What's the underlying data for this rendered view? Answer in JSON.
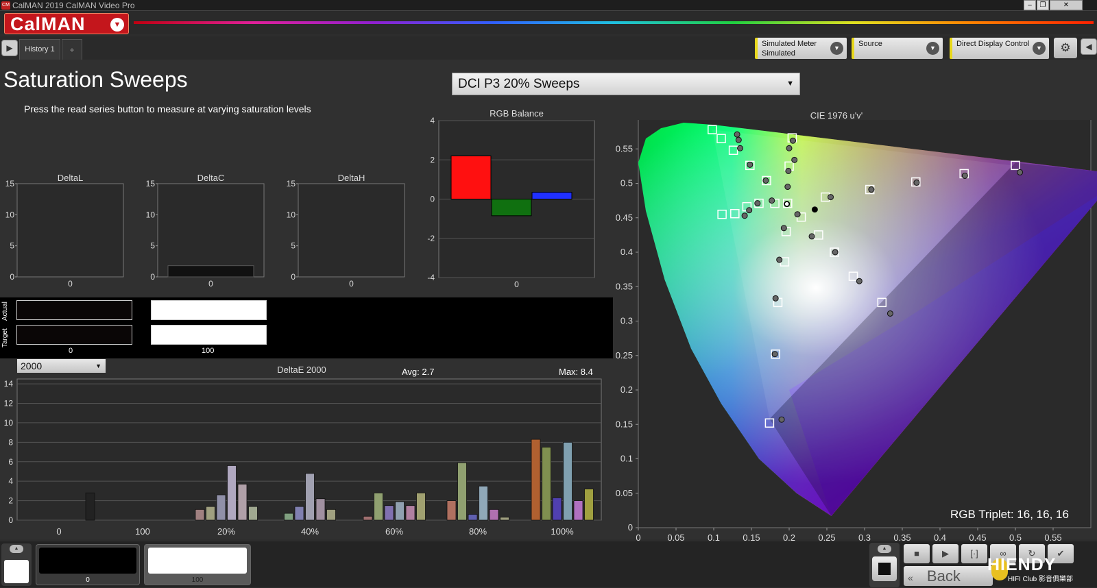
{
  "window": {
    "title": "CalMAN 2019 CalMAN Video Pro",
    "app_icon": "CM"
  },
  "brand": {
    "logo": "CalMAN"
  },
  "tabs": {
    "history": "History 1",
    "add": "+"
  },
  "devices": {
    "meter_label": "Simulated Meter",
    "meter_sub": "Simulated",
    "source_label": "Source",
    "display_label": "Direct Display Control"
  },
  "page": {
    "title": "Saturation Sweeps",
    "subtitle": "Press the read series button to measure at varying saturation levels",
    "series_select": "DCI P3 20% Sweeps"
  },
  "delta_charts": [
    {
      "title": "DeltaL",
      "yticks": [
        "15",
        "10",
        "5",
        "0"
      ],
      "xlabel": "0",
      "value": 0
    },
    {
      "title": "DeltaC",
      "yticks": [
        "15",
        "10",
        "5",
        "0"
      ],
      "xlabel": "0",
      "value": 1.8
    },
    {
      "title": "DeltaH",
      "yticks": [
        "15",
        "10",
        "5",
        "0"
      ],
      "xlabel": "0",
      "value": 0
    }
  ],
  "rgb_balance": {
    "title": "RGB Balance",
    "yticks": [
      "4",
      "2",
      "0",
      "-2",
      "-4"
    ],
    "xlabel": "0",
    "values": {
      "red": 2.2,
      "green": -0.85,
      "blue": 0.35
    }
  },
  "swatches": {
    "actual_label": "Actual",
    "target_label": "Target",
    "items": [
      {
        "label": "0",
        "color": "#0a0606"
      },
      {
        "label": "100",
        "color": "#ffffff"
      }
    ]
  },
  "deltae": {
    "title": "DeltaE 2000",
    "mode": "2000",
    "avg": "Avg: 2.7",
    "max": "Max: 8.4",
    "yticks": [
      "14",
      "12",
      "10",
      "8",
      "6",
      "4",
      "2",
      "0"
    ],
    "xticks": [
      "0",
      "100",
      "20%",
      "40%",
      "60%",
      "80%",
      "100%"
    ]
  },
  "chart_data": [
    {
      "type": "bar",
      "title": "DeltaE 2000",
      "ylim": [
        0,
        15
      ],
      "groups": [
        {
          "category": "0",
          "bars": [
            {
              "value": 2.8,
              "color": "#222222"
            }
          ]
        },
        {
          "category": "100",
          "bars": []
        },
        {
          "category": "20%",
          "bars": [
            {
              "value": 1.1,
              "color": "#a08080"
            },
            {
              "value": 1.4,
              "color": "#a0a080"
            },
            {
              "value": 2.6,
              "color": "#9090a8"
            },
            {
              "value": 5.6,
              "color": "#b0a8c0"
            },
            {
              "value": 3.7,
              "color": "#b0a0a8"
            },
            {
              "value": 1.4,
              "color": "#a0a890"
            }
          ]
        },
        {
          "category": "40%",
          "bars": [
            {
              "value": 0.7,
              "color": "#80a080"
            },
            {
              "value": 1.4,
              "color": "#8080b0"
            },
            {
              "value": 4.8,
              "color": "#a0a0b0"
            },
            {
              "value": 2.2,
              "color": "#a090a0"
            },
            {
              "value": 1.1,
              "color": "#a0a080"
            }
          ]
        },
        {
          "category": "60%",
          "bars": [
            {
              "value": 0.4,
              "color": "#a07070"
            },
            {
              "value": 2.8,
              "color": "#90a070"
            },
            {
              "value": 1.5,
              "color": "#8070b0"
            },
            {
              "value": 1.9,
              "color": "#90a0b0"
            },
            {
              "value": 1.5,
              "color": "#b080a0"
            },
            {
              "value": 2.8,
              "color": "#a0a070"
            }
          ]
        },
        {
          "category": "80%",
          "bars": [
            {
              "value": 2.0,
              "color": "#b07060"
            },
            {
              "value": 5.9,
              "color": "#90a070"
            },
            {
              "value": 0.6,
              "color": "#6060b0"
            },
            {
              "value": 3.5,
              "color": "#90a8b8"
            },
            {
              "value": 1.1,
              "color": "#b070b0"
            },
            {
              "value": 0.3,
              "color": "#a0a080"
            }
          ]
        },
        {
          "category": "100%",
          "bars": [
            {
              "value": 8.3,
              "color": "#b06030"
            },
            {
              "value": 7.5,
              "color": "#809050"
            },
            {
              "value": 2.3,
              "color": "#5040b0"
            },
            {
              "value": 8.0,
              "color": "#80a0b0"
            },
            {
              "value": 2.0,
              "color": "#b070c0"
            },
            {
              "value": 3.2,
              "color": "#a0a040"
            }
          ]
        }
      ]
    },
    {
      "type": "scatter",
      "title": "CIE 1976 u'v'",
      "xlim": [
        0,
        0.6
      ],
      "ylim": [
        0,
        0.6
      ],
      "xticks": [
        "0",
        "0.05",
        "0.1",
        "0.15",
        "0.2",
        "0.25",
        "0.3",
        "0.35",
        "0.4",
        "0.45",
        "0.5",
        "0.55"
      ],
      "yticks": [
        "0",
        "0.05",
        "0.1",
        "0.15",
        "0.2",
        "0.25",
        "0.3",
        "0.35",
        "0.4",
        "0.45",
        "0.5",
        "0.55"
      ],
      "triplet": "RGB Triplet: 16, 16, 16",
      "targets": [
        [
          0.098,
          0.578
        ],
        [
          0.11,
          0.565
        ],
        [
          0.126,
          0.548
        ],
        [
          0.148,
          0.526
        ],
        [
          0.17,
          0.504
        ],
        [
          0.111,
          0.455
        ],
        [
          0.128,
          0.456
        ],
        [
          0.144,
          0.466
        ],
        [
          0.16,
          0.471
        ],
        [
          0.181,
          0.471
        ],
        [
          0.204,
          0.566
        ],
        [
          0.2,
          0.525
        ],
        [
          0.198,
          0.471
        ],
        [
          0.196,
          0.43
        ],
        [
          0.194,
          0.386
        ],
        [
          0.185,
          0.327
        ],
        [
          0.182,
          0.252
        ],
        [
          0.174,
          0.152
        ],
        [
          0.216,
          0.451
        ],
        [
          0.239,
          0.425
        ],
        [
          0.26,
          0.4
        ],
        [
          0.285,
          0.365
        ],
        [
          0.323,
          0.327
        ],
        [
          0.248,
          0.48
        ],
        [
          0.307,
          0.491
        ],
        [
          0.368,
          0.502
        ],
        [
          0.432,
          0.514
        ],
        [
          0.5,
          0.526
        ]
      ],
      "measured": [
        [
          0.131,
          0.571
        ],
        [
          0.133,
          0.563
        ],
        [
          0.135,
          0.551
        ],
        [
          0.148,
          0.527
        ],
        [
          0.169,
          0.504
        ],
        [
          0.141,
          0.453
        ],
        [
          0.147,
          0.461
        ],
        [
          0.158,
          0.471
        ],
        [
          0.177,
          0.475
        ],
        [
          0.205,
          0.562
        ],
        [
          0.2,
          0.551
        ],
        [
          0.207,
          0.534
        ],
        [
          0.199,
          0.518
        ],
        [
          0.198,
          0.495
        ],
        [
          0.211,
          0.455
        ],
        [
          0.193,
          0.435
        ],
        [
          0.187,
          0.389
        ],
        [
          0.182,
          0.333
        ],
        [
          0.181,
          0.252
        ],
        [
          0.19,
          0.157
        ],
        [
          0.23,
          0.423
        ],
        [
          0.261,
          0.4
        ],
        [
          0.293,
          0.358
        ],
        [
          0.334,
          0.311
        ],
        [
          0.255,
          0.48
        ],
        [
          0.309,
          0.491
        ],
        [
          0.369,
          0.501
        ],
        [
          0.433,
          0.511
        ],
        [
          0.506,
          0.516
        ],
        [
          0.234,
          0.462
        ],
        [
          0.197,
          0.47
        ]
      ]
    }
  ],
  "bottom": {
    "thumbs": [
      {
        "label": "0"
      },
      {
        "label": "100"
      }
    ],
    "back": "Back",
    "watermark": "HIENDY",
    "watermark_sub": "HIFI Club 影音俱樂部"
  }
}
